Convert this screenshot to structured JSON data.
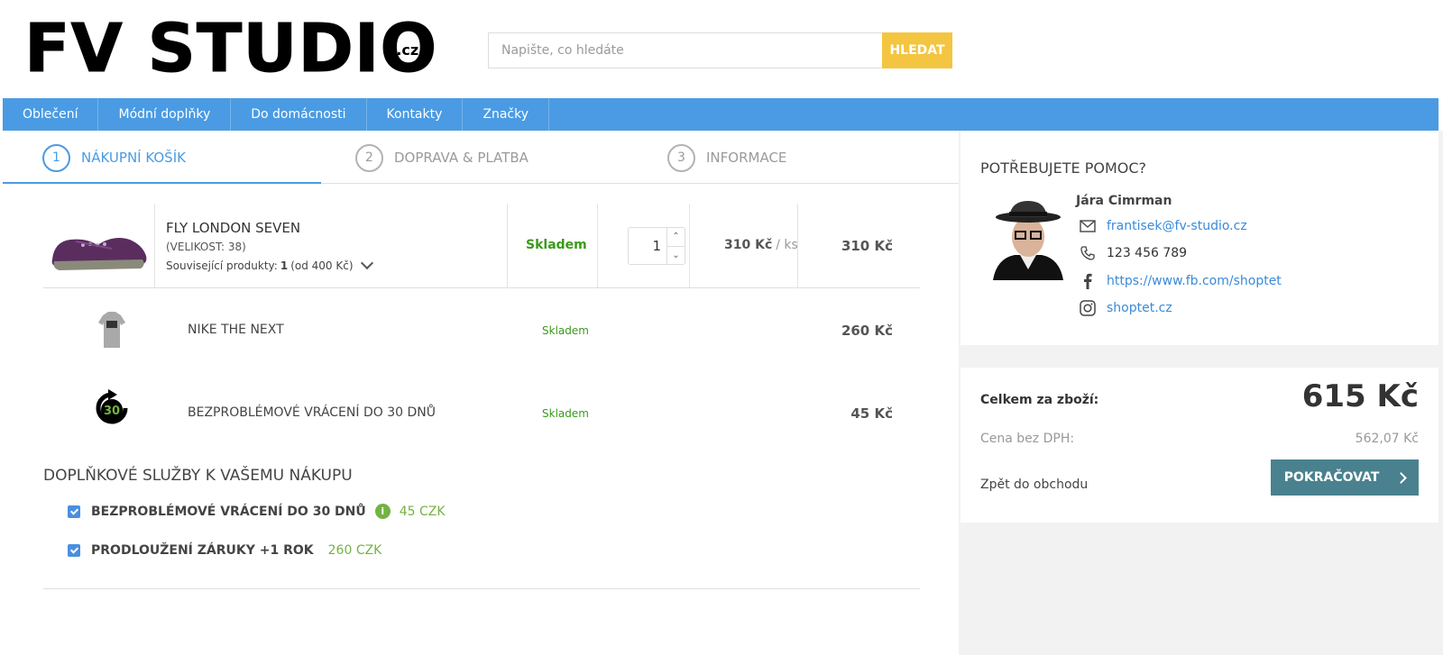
{
  "header": {
    "logo_text": "FV STUDIO",
    "logo_suffix": ".cz",
    "search_placeholder": "Napište, co hledáte",
    "search_button": "HLEDAT"
  },
  "nav": {
    "items": [
      {
        "label": "Oblečení"
      },
      {
        "label": "Módní doplňky"
      },
      {
        "label": "Do domácnosti"
      },
      {
        "label": "Kontakty"
      },
      {
        "label": "Značky"
      }
    ]
  },
  "steps": [
    {
      "num": "1",
      "label": "NÁKUPNÍ KOŠÍK",
      "active": true
    },
    {
      "num": "2",
      "label": "DOPRAVA & PLATBA",
      "active": false
    },
    {
      "num": "3",
      "label": "INFORMACE",
      "active": false
    }
  ],
  "cart": {
    "main_item": {
      "name": "FLY LONDON SEVEN",
      "size": "(VELIKOST: 38)",
      "related_prefix": "Související produkty:",
      "related_count": "1",
      "related_suffix": "(od 400 Kč)",
      "stock": "Skladem",
      "quantity": "1",
      "unit_price": "310 Kč",
      "unit_suffix": "/ ks",
      "total": "310 Kč"
    },
    "sub_items": [
      {
        "name": "NIKE THE NEXT",
        "stock": "Skladem",
        "price": "260 Kč"
      },
      {
        "name": "BEZPROBLÉMOVÉ VRÁCENÍ DO 30 DNŮ",
        "stock": "Skladem",
        "price": "45 Kč"
      }
    ],
    "return_icon_text": "30"
  },
  "addons": {
    "title": "DOPLŇKOVÉ SLUŽBY K VAŠEMU NÁKUPU",
    "items": [
      {
        "name": "BEZPROBLÉMOVÉ VRÁCENÍ DO 30 DNŮ",
        "price": "45 CZK",
        "checked": true,
        "info_icon": "i"
      },
      {
        "name": "PRODLOUŽENÍ ZÁRUKY +1 ROK",
        "price": "260 CZK",
        "checked": true
      }
    ]
  },
  "help": {
    "title": "POTŘEBUJETE POMOC?",
    "name": "Jára Cimrman",
    "email": "frantisek@fv-studio.cz",
    "phone": "123 456 789",
    "facebook": "https://www.fb.com/shoptet",
    "instagram": "shoptet.cz"
  },
  "summary": {
    "total_label": "Celkem za zboží:",
    "total_value": "615 Kč",
    "net_label": "Cena bez DPH:",
    "net_value": "562,07 Kč",
    "back_label": "Zpět do obchodu",
    "continue_label": "POKRAČOVAT"
  },
  "colors": {
    "accent": "#4a9be3",
    "search_button": "#f4c540",
    "stock_green": "#3a9a1a",
    "addon_price_green": "#74b243",
    "continue_button": "#4a818f",
    "side_background": "#f2f2f2"
  }
}
